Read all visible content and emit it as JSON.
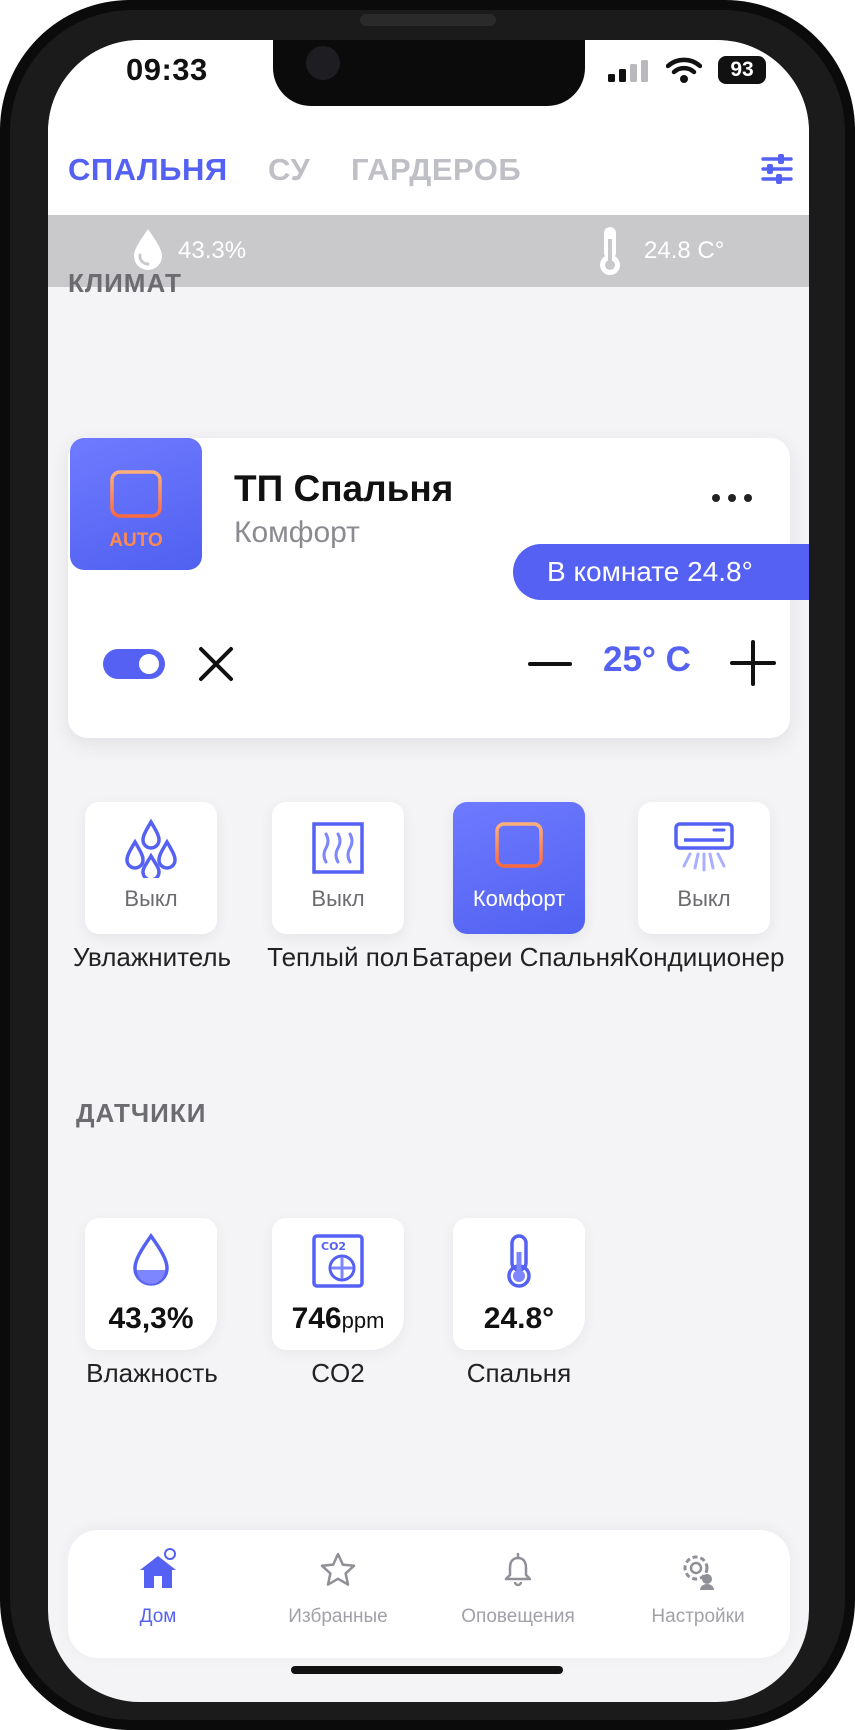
{
  "status_bar": {
    "time": "09:33",
    "battery": "93"
  },
  "tabs": [
    {
      "label": "СПАЛЬНЯ",
      "active": true
    },
    {
      "label": "СУ",
      "active": false
    },
    {
      "label": "ГАРДЕРОБ",
      "active": false
    }
  ],
  "climate_bar": {
    "humidity": "43.3%",
    "temperature": "24.8 C°"
  },
  "sections": {
    "climate": "КЛИМАТ",
    "sensors": "ДАТЧИКИ"
  },
  "thermostat": {
    "badge": "AUTO",
    "title": "ТП Спальня",
    "mode": "Комфорт",
    "room_temp": "В комнате 24.8°",
    "target": "25° C",
    "enabled": true
  },
  "devices": [
    {
      "state": "Выкл",
      "label": "Увлажнитель",
      "icon": "droplets-icon",
      "active": false
    },
    {
      "state": "Выкл",
      "label": "Теплый пол",
      "icon": "heated-floor-icon",
      "active": false
    },
    {
      "state": "Комфорт",
      "label": "Батареи Спальня",
      "icon": "radiator-icon",
      "active": true
    },
    {
      "state": "Выкл",
      "label": "Кондиционер",
      "icon": "air-conditioner-icon",
      "active": false
    }
  ],
  "sensors": [
    {
      "value": "43,3%",
      "unit": "",
      "label": "Влажность",
      "icon": "humidity-icon"
    },
    {
      "value": "746",
      "unit": "ppm",
      "label": "CO2",
      "icon": "co2-icon"
    },
    {
      "value": "24.8°",
      "unit": "",
      "label": "Спальня",
      "icon": "thermometer-icon"
    }
  ],
  "nav": [
    {
      "label": "Дом",
      "icon": "home-icon",
      "active": true
    },
    {
      "label": "Избранные",
      "icon": "star-icon",
      "active": false
    },
    {
      "label": "Оповещения",
      "icon": "bell-icon",
      "active": false
    },
    {
      "label": "Настройки",
      "icon": "settings-icon",
      "active": false
    }
  ],
  "colors": {
    "accent": "#5561f2",
    "climate_bar": "#c9c9cc",
    "background": "#f4f4f6"
  }
}
